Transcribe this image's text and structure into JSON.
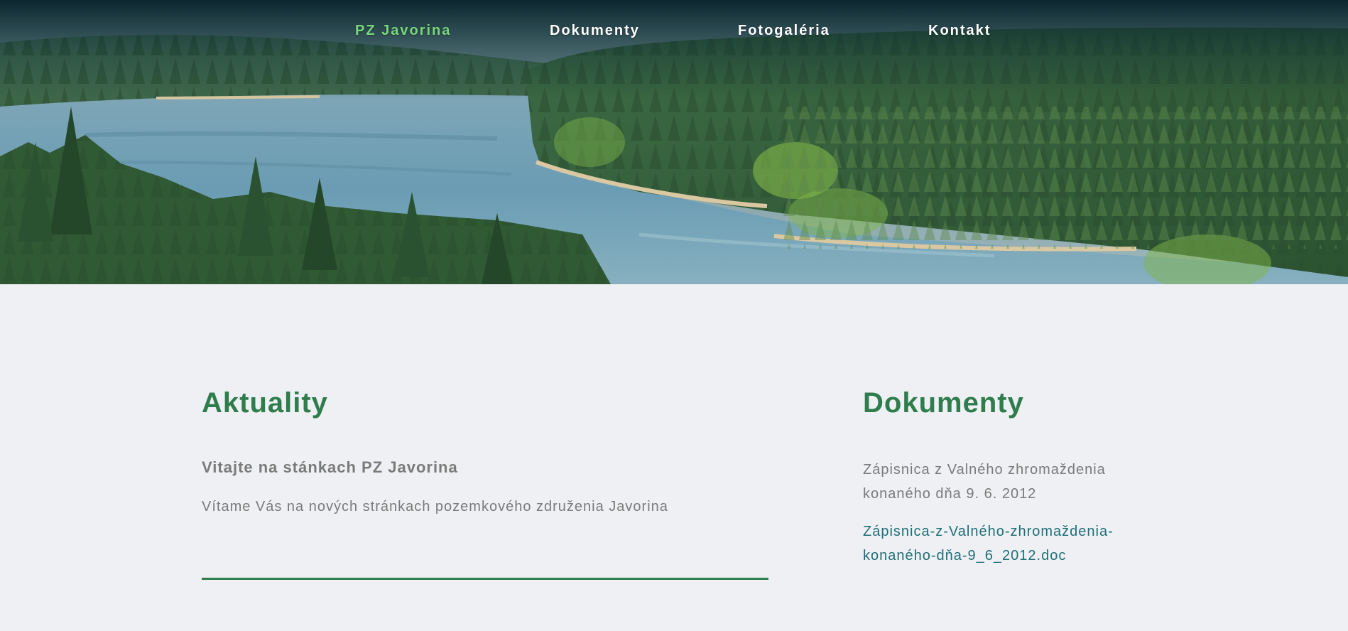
{
  "nav": {
    "items": [
      {
        "label": "PZ Javorina",
        "active": true
      },
      {
        "label": "Dokumenty",
        "active": false
      },
      {
        "label": "Fotogaléria",
        "active": false
      },
      {
        "label": "Kontakt",
        "active": false
      }
    ]
  },
  "colors": {
    "accent": "#2f7d4c",
    "active_nav": "#78d77c",
    "link": "#1e6f76",
    "text": "#7a7a7a",
    "background": "#eff0f4"
  },
  "news": {
    "heading": "Aktuality",
    "title": "Vitajte na stánkach PZ Javorina",
    "text": "Vítame Vás na nových stránkach pozemkového združenia Javorina"
  },
  "documents": {
    "heading": "Dokumenty",
    "text": "Zápisnica z Valného zhromaždenia konaného dňa 9. 6. 2012",
    "link": "Zápisnica-z-Valného-zhromaždenia-konaného-dňa-9_6_2012.doc"
  }
}
